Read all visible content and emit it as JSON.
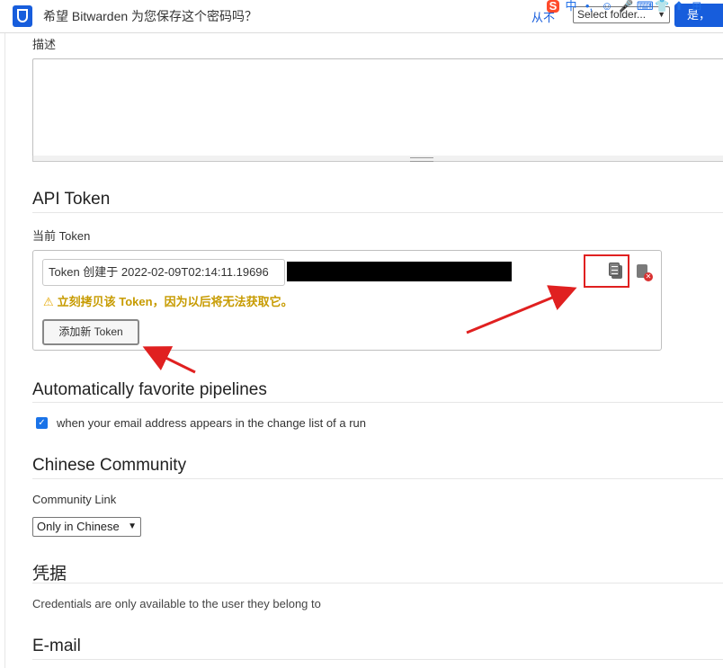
{
  "bitwarden": {
    "prompt": "希望 Bitwarden 为您保存这个密码吗？",
    "never_label": "从不",
    "folder_select": "Select folder...",
    "save_label": "是，"
  },
  "ime": [
    "S",
    "中",
    "•,",
    "☺",
    "🎤",
    "⌨",
    "👕",
    "⬆",
    "⊞"
  ],
  "description": {
    "label": "描述",
    "value": ""
  },
  "api_token": {
    "title": "API Token",
    "current_label": "当前 Token",
    "token_value": "Token 创建于 2022-02-09T02:14:11.19696",
    "warning": "立刻拷贝该 Token，因为以后将无法获取它。",
    "add_button": "添加新 Token"
  },
  "pipelines": {
    "title": "Automatically favorite pipelines",
    "checkbox_label": "when your email address appears in the change list of a run",
    "checked": true
  },
  "chinese_community": {
    "title": "Chinese Community",
    "link_label": "Community Link",
    "select_value": "Only in Chinese"
  },
  "credentials": {
    "title": "凭据",
    "text": "Credentials are only available to the user they belong to"
  },
  "email": {
    "title": "E-mail"
  }
}
